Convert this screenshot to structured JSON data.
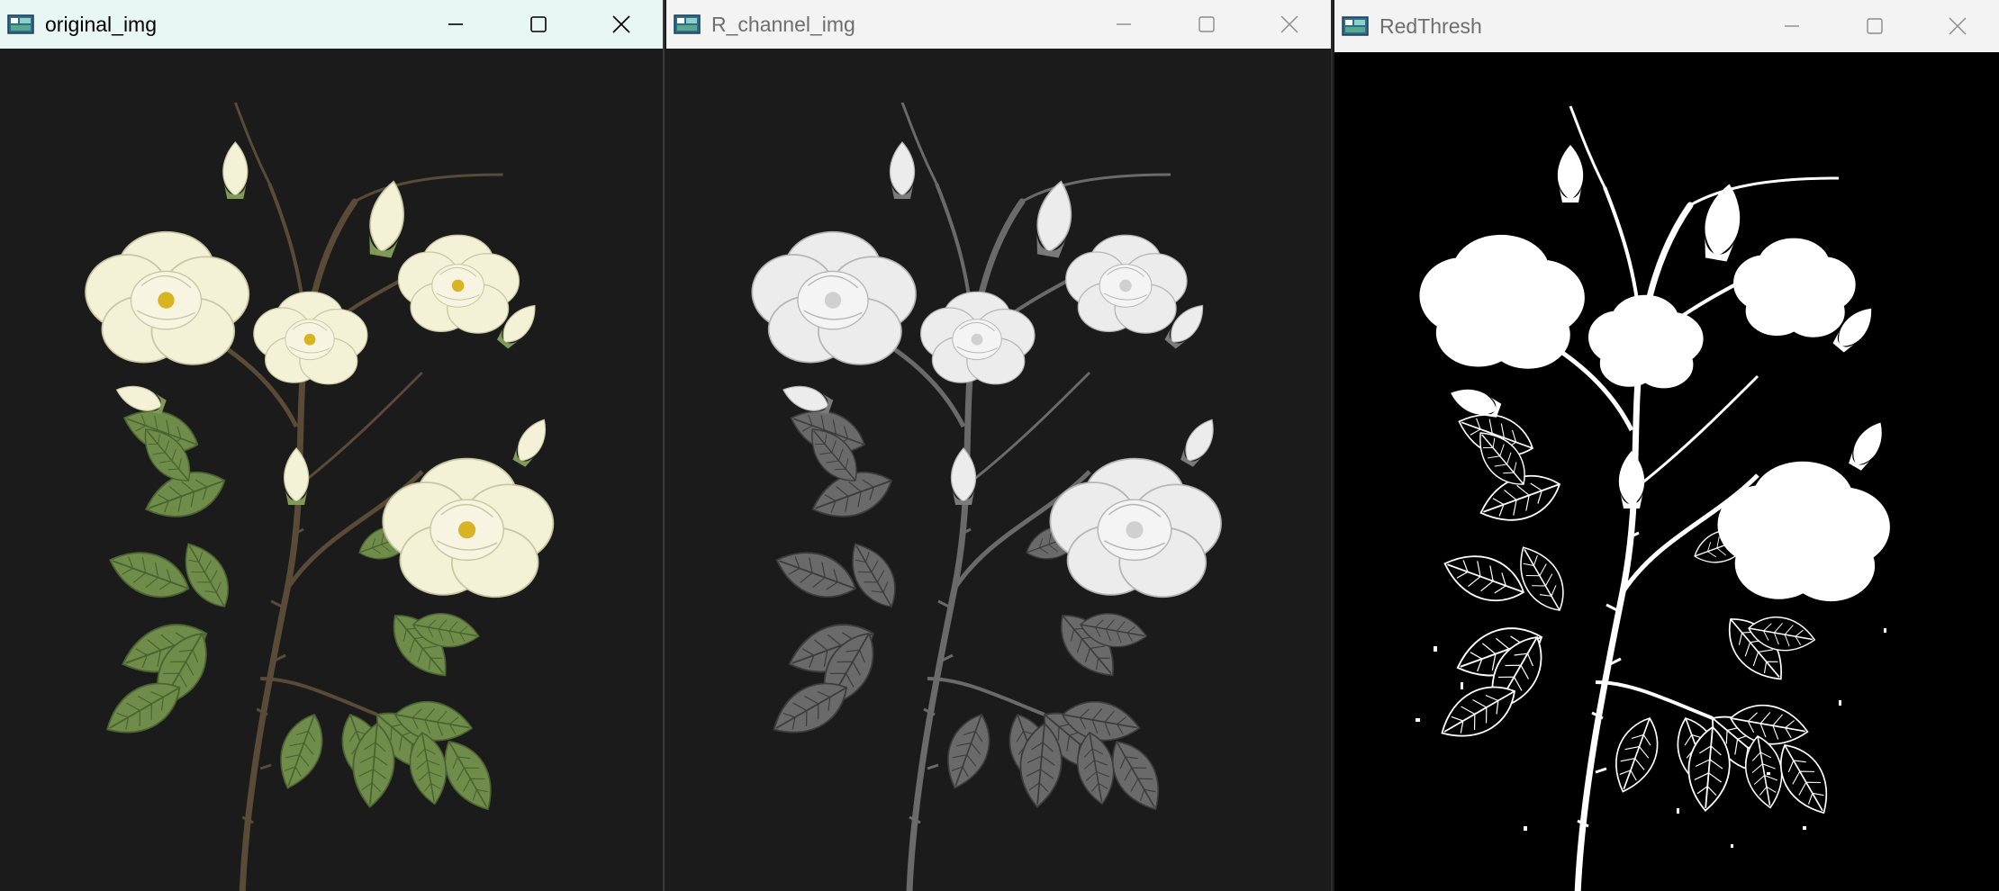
{
  "windows": [
    {
      "title": "original_img",
      "active": true,
      "controls": [
        "minimize-icon",
        "maximize-icon",
        "close-icon"
      ],
      "image": "color botanical illustration of white roses with green leaves on dark background"
    },
    {
      "title": "R_channel_img",
      "active": false,
      "controls": [
        "minimize-icon",
        "maximize-icon",
        "close-icon"
      ],
      "image": "grayscale red channel of rose illustration"
    },
    {
      "title": "RedThresh",
      "active": false,
      "controls": [
        "minimize-icon",
        "maximize-icon",
        "close-icon"
      ],
      "image": "binary thresholded mask of roses, white on black"
    }
  ],
  "colors": {
    "active_titlebar": "#e9f7f4",
    "inactive_titlebar": "#f3f3f3",
    "image_background": "#1b1b1b",
    "leaf_green": "#6f8c4a",
    "petal_cream": "#f3f1d6",
    "stamen_yellow": "#d9b422"
  }
}
